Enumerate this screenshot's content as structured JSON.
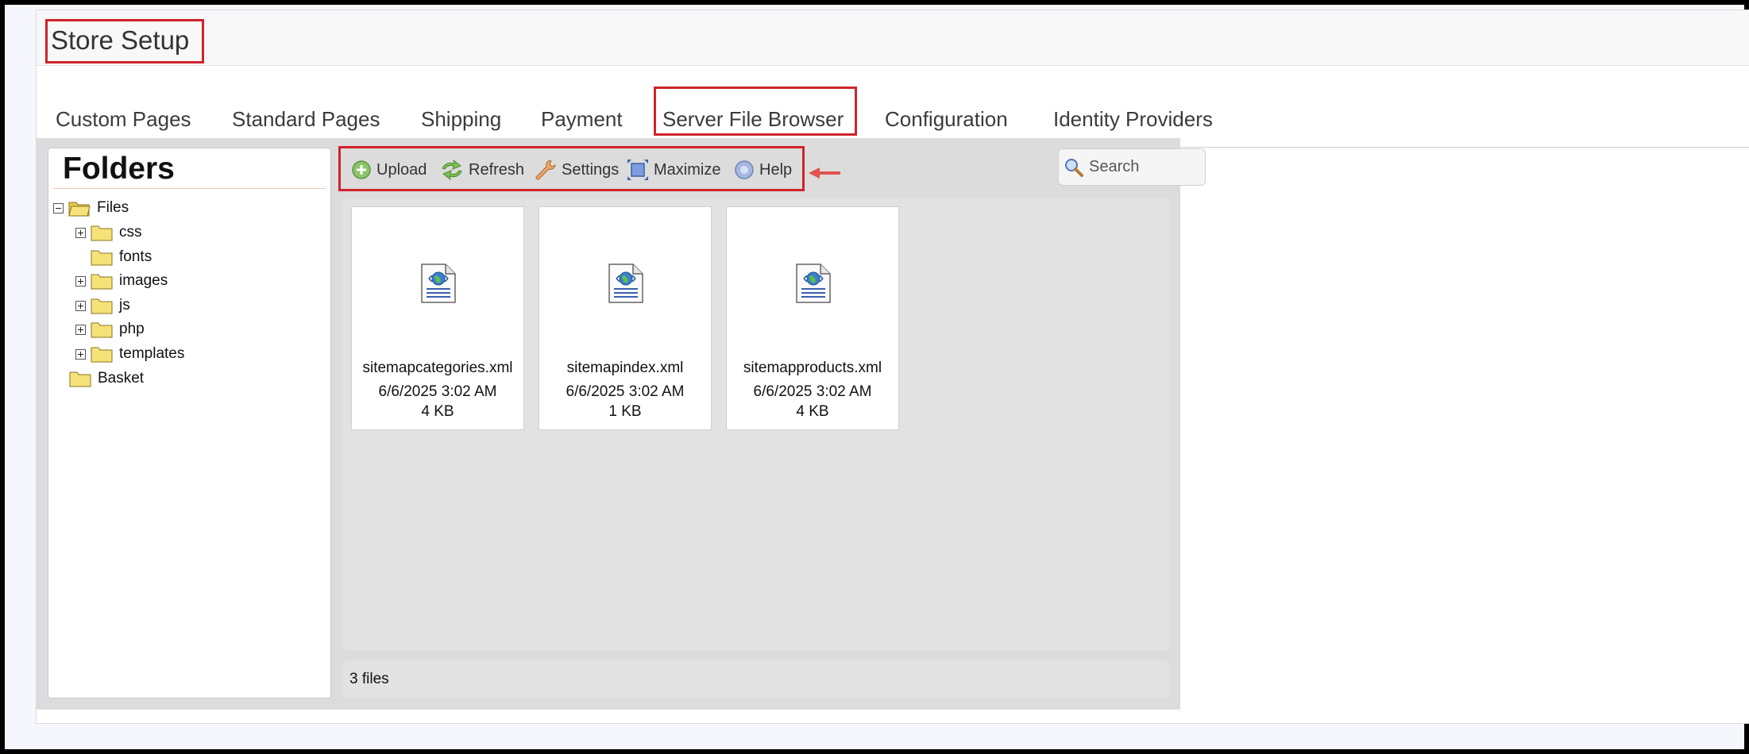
{
  "header": {
    "title": "Store Setup"
  },
  "tabs": [
    {
      "label": "Custom Pages"
    },
    {
      "label": "Standard Pages"
    },
    {
      "label": "Shipping"
    },
    {
      "label": "Payment"
    },
    {
      "label": "Server File Browser"
    },
    {
      "label": "Configuration"
    },
    {
      "label": "Identity Providers"
    }
  ],
  "active_tab": "Server File Browser",
  "folders": {
    "title": "Folders",
    "tree": [
      {
        "label": "Files",
        "toggle": "minus"
      },
      {
        "label": "css",
        "toggle": "plus"
      },
      {
        "label": "fonts",
        "toggle": "none"
      },
      {
        "label": "images",
        "toggle": "plus"
      },
      {
        "label": "js",
        "toggle": "plus"
      },
      {
        "label": "php",
        "toggle": "plus"
      },
      {
        "label": "templates",
        "toggle": "plus"
      },
      {
        "label": "Basket",
        "toggle": "none"
      }
    ]
  },
  "toolbar": {
    "upload": "Upload",
    "refresh": "Refresh",
    "settings": "Settings",
    "maximize": "Maximize",
    "help": "Help"
  },
  "search": {
    "placeholder": "Search"
  },
  "files": [
    {
      "name": "sitemapcategories.xml",
      "date": "6/6/2025 3:02 AM",
      "size": "4 KB"
    },
    {
      "name": "sitemapindex.xml",
      "date": "6/6/2025 3:02 AM",
      "size": "1 KB"
    },
    {
      "name": "sitemapproducts.xml",
      "date": "6/6/2025 3:02 AM",
      "size": "4 KB"
    }
  ],
  "status": {
    "text": "3 files"
  },
  "colors": {
    "highlight": "#d0232a",
    "folder": "#f7e27a",
    "panel": "#dcdcdc"
  },
  "icons": {
    "upload": "plus-circle-icon",
    "refresh": "refresh-arrows-icon",
    "settings": "wrench-icon",
    "maximize": "maximize-icon",
    "help": "help-icon",
    "search": "magnifier-icon",
    "folder": "folder-icon",
    "file": "xml-document-icon"
  }
}
